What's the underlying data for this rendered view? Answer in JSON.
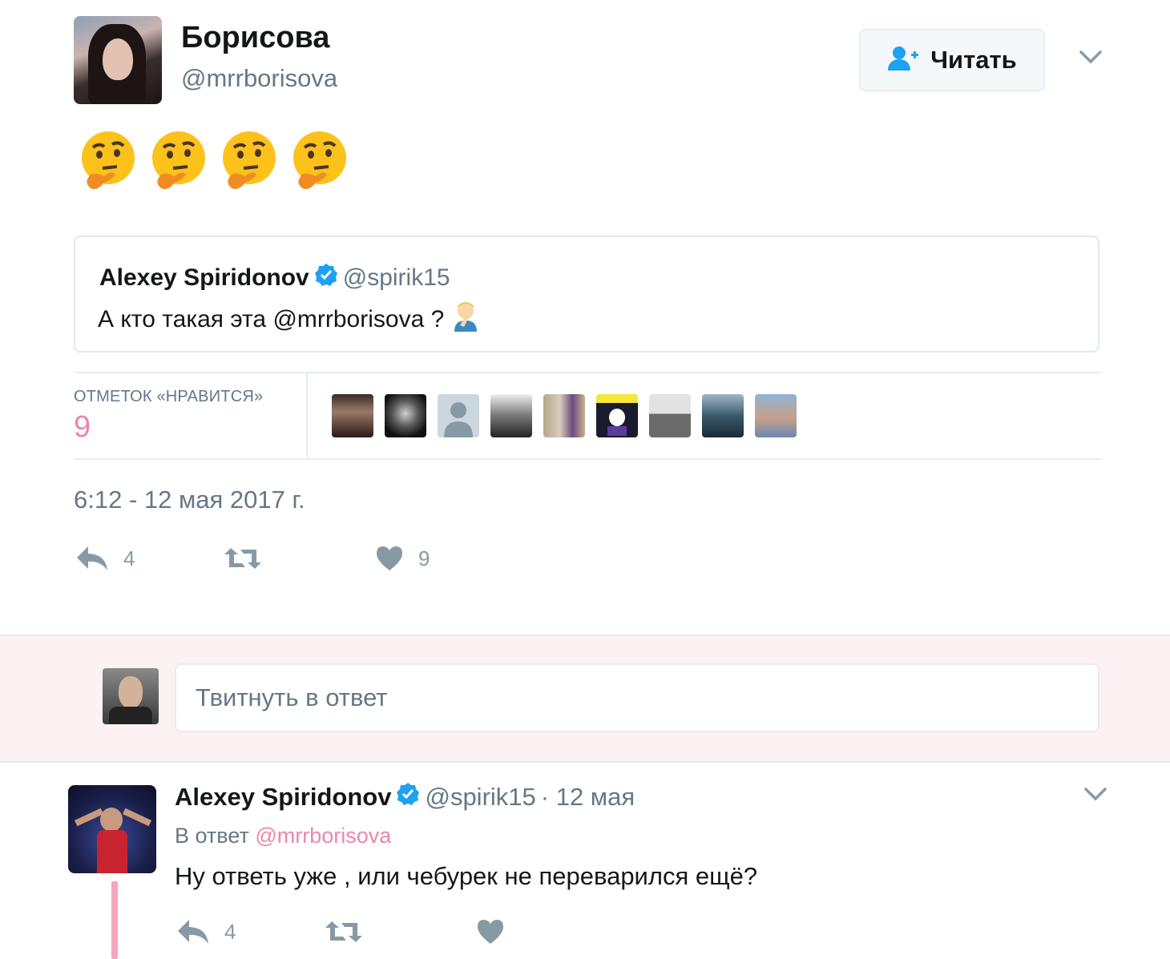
{
  "tweet": {
    "author_name": "Борисова",
    "author_handle": "@mrrborisova",
    "follow_label": "Читать",
    "emoji": [
      "thinking-face",
      "thinking-face",
      "thinking-face",
      "thinking-face"
    ],
    "quote": {
      "author_name": "Alexey Spiridonov",
      "author_handle": "@spirik15",
      "text": "А кто такая эта @mrrborisova ?",
      "emoji": "man-facepalming"
    },
    "likes_label": "ОТМЕТОК «НРАВИТСЯ»",
    "likes_count": "9",
    "timestamp": "6:12 - 12 мая 2017 г.",
    "reply_count": "4",
    "like_count": "9"
  },
  "reply_box": {
    "placeholder": "Твитнуть в ответ"
  },
  "reply": {
    "author_name": "Alexey Spiridonov",
    "author_handle": "@spirik15",
    "date": "· 12 мая",
    "in_reply_prefix": "В ответ",
    "in_reply_handle": "@mrrborisova",
    "text": "Ну ответь уже , или чебурек не переварился ещё?",
    "reply_count": "4"
  },
  "colors": {
    "like_accent": "#e0245e",
    "verified_blue": "#1da1f2",
    "muted": "#657786"
  }
}
